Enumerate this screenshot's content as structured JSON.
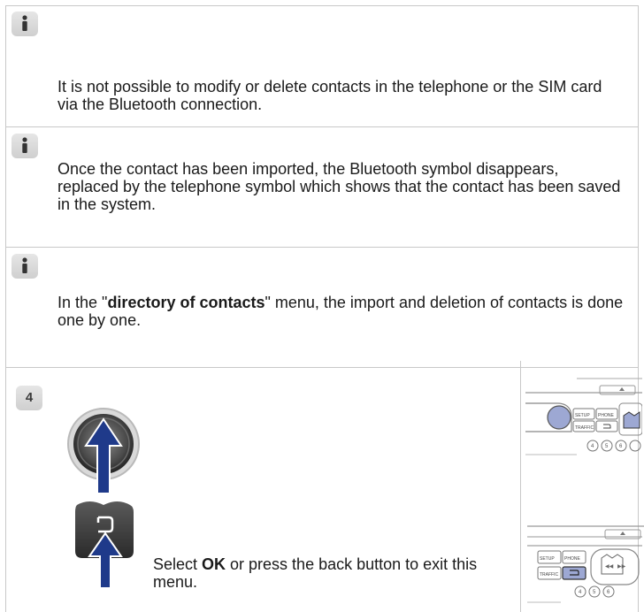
{
  "notes": [
    {
      "icon": "info-icon",
      "text": "It is not possible to modify or delete contacts in the telephone or the SIM card via the Bluetooth connection."
    },
    {
      "icon": "info-icon",
      "text": "Once the contact has been imported, the Bluetooth symbol disappears, replaced by the telephone symbol which shows that the contact has been saved in the system."
    },
    {
      "icon": "info-icon",
      "text_before": "In the \"",
      "text_bold": "directory of contacts",
      "text_after": "\" menu, the import and deletion of contacts is done one by one."
    }
  ],
  "step": {
    "number": "4",
    "text_before": "Select ",
    "text_bold": "OK",
    "text_after": " or press the back button to exit this menu.",
    "icons": [
      "rotary-knob-press-icon",
      "back-button-press-icon"
    ],
    "panel_labels": {
      "setup": "SETUP",
      "phone": "PHONE",
      "traffic": "TRAFFIC",
      "knob_buttons_1": [
        "4",
        "5",
        "6"
      ],
      "knob_buttons_2": [
        "4",
        "5",
        "6"
      ]
    },
    "accent_color": "#9da8d3",
    "arrow_color": "#1f3a8a"
  }
}
